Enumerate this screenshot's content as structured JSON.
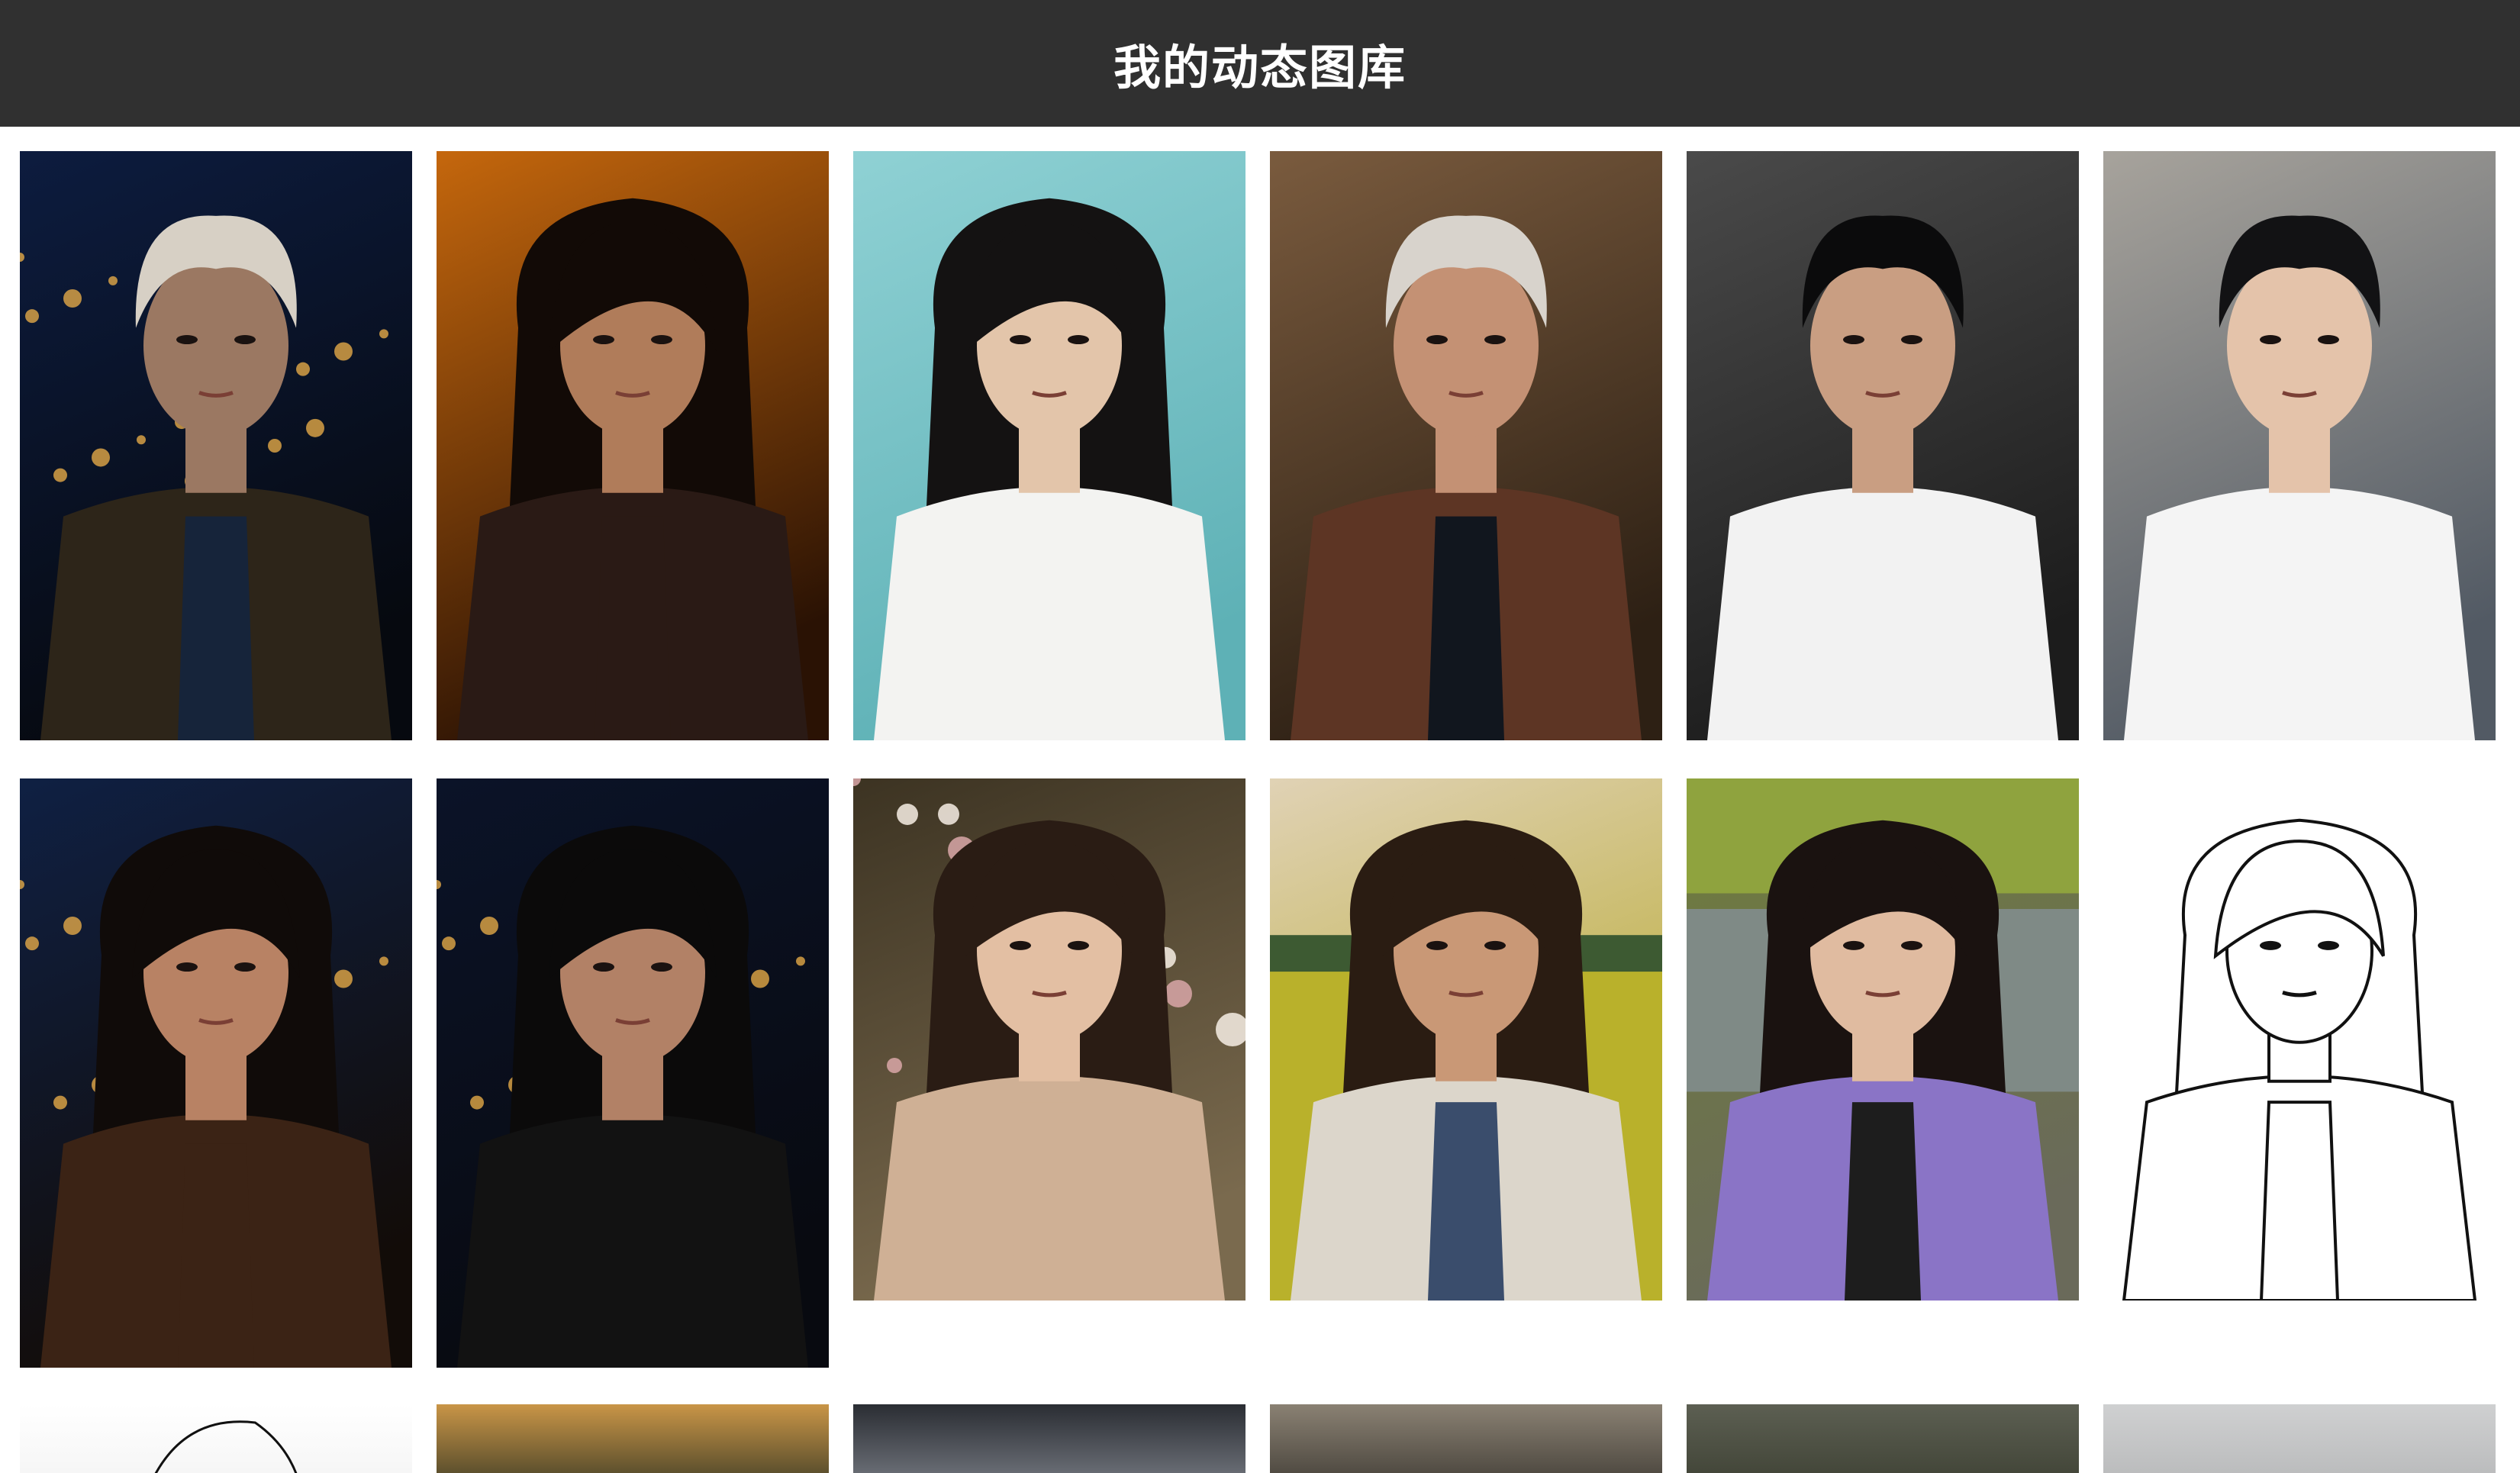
{
  "header": {
    "title": "我的动态图库"
  },
  "gallery": {
    "rows": [
      [
        {
          "name": "old-man-night-street-photo",
          "bg": [
            "#0d1c3f",
            "#06090f"
          ],
          "skin": "#9b7862",
          "hair": "#d7d0c5",
          "cloth": "#2d2519",
          "shirt": "#16243a",
          "shortHair": true,
          "lights": true
        },
        {
          "name": "woman-orange-shadow-photo",
          "bg": [
            "#c5670d",
            "#2a1204"
          ],
          "skin": "#b07c5a",
          "hair": "#120a06",
          "cloth": "#2a1a15",
          "shirt": "#2a1a15",
          "longHair": true
        },
        {
          "name": "girl-white-shirt-teal-wall-photo",
          "bg": [
            "#8fd1d4",
            "#5eb1b6"
          ],
          "skin": "#e3c5aa",
          "hair": "#141212",
          "cloth": "#f3f3f1",
          "shirt": "#f3f3f1",
          "longHair": true
        },
        {
          "name": "old-man-brown-suit-photo",
          "bg": [
            "#7a5b3e",
            "#2d2014"
          ],
          "skin": "#c49174",
          "hair": "#d8d3cc",
          "cloth": "#5d3524",
          "shirt": "#11161e",
          "shortHair": true
        },
        {
          "name": "young-man-dark-background-photo",
          "bg": [
            "#4a4a4a",
            "#1c1c1c"
          ],
          "skin": "#c99e82",
          "hair": "#0b0b0c",
          "cloth": "#f2f2f2",
          "shirt": "#f2f2f2",
          "shortHair": true
        },
        {
          "name": "young-man-white-shirt-photo",
          "bg": [
            "#a7a39c",
            "#525a64"
          ],
          "skin": "#e4c3aa",
          "hair": "#121214",
          "cloth": "#f4f4f4",
          "shirt": "#f4f4f4",
          "shortHair": true
        }
      ],
      [
        {
          "name": "woman-city-lights-night-photo",
          "bg": [
            "#0f2043",
            "#120c08"
          ],
          "skin": "#b88264",
          "hair": "#100b09",
          "cloth": "#3b2315",
          "shirt": "#3b2315",
          "longHair": true,
          "lights": true
        },
        {
          "name": "woman-night-bay-photo",
          "bg": [
            "#0b1328",
            "#080a10"
          ],
          "skin": "#b28166",
          "hair": "#0b0a0a",
          "cloth": "#121212",
          "shirt": "#121212",
          "longHair": true,
          "lights": true
        },
        {
          "name": "woman-blossom-tree-photo",
          "bg": [
            "#3c3322",
            "#7a6a4e"
          ],
          "skin": "#e3bfa3",
          "hair": "#2a1c14",
          "cloth": "#cfb095",
          "shirt": "#cfb095",
          "longHair": true,
          "blossom": true
        },
        {
          "name": "woman-rapeseed-field-photo",
          "bg": [
            "#e0d2b5",
            "#b6a82a"
          ],
          "skin": "#c99876",
          "hair": "#2a1c12",
          "cloth": "#dcd6cb",
          "shirt": "#3a4d6c",
          "longHair": true,
          "field": true
        },
        {
          "name": "woman-purple-jacket-river-photo",
          "bg": [
            "#6f7d3c",
            "#6a6a5a"
          ],
          "skin": "#e0bba0",
          "hair": "#1a1210",
          "cloth": "#8a74c6",
          "shirt": "#1d1d1d",
          "longHair": true,
          "river": true
        },
        {
          "name": "woman-line-art-sketch",
          "bg": [
            "#ffffff",
            "#ffffff"
          ],
          "skin": "#ffffff",
          "hair": "#111111",
          "cloth": "#ffffff",
          "shirt": "#ffffff",
          "longHair": true,
          "sketch": true
        }
      ],
      [
        {
          "name": "man-line-art-sketch",
          "bg": [
            "#ffffff",
            "#f3f3f3"
          ],
          "sketch": true
        },
        {
          "name": "sunset-field-bridge-photo",
          "bg": [
            "#c99547",
            "#3a3a25"
          ]
        },
        {
          "name": "subway-train-interior-photo",
          "bg": [
            "#2a2d33",
            "#7c8088"
          ]
        },
        {
          "name": "woman-flowers-sepia-photo",
          "bg": [
            "#8a8173",
            "#3e3a33"
          ]
        },
        {
          "name": "woman-forest-photo",
          "bg": [
            "#5c5f52",
            "#3c3f32"
          ]
        },
        {
          "name": "gray-sky-photo",
          "bg": [
            "#cfd0d1",
            "#b5b6b7"
          ]
        }
      ]
    ]
  }
}
